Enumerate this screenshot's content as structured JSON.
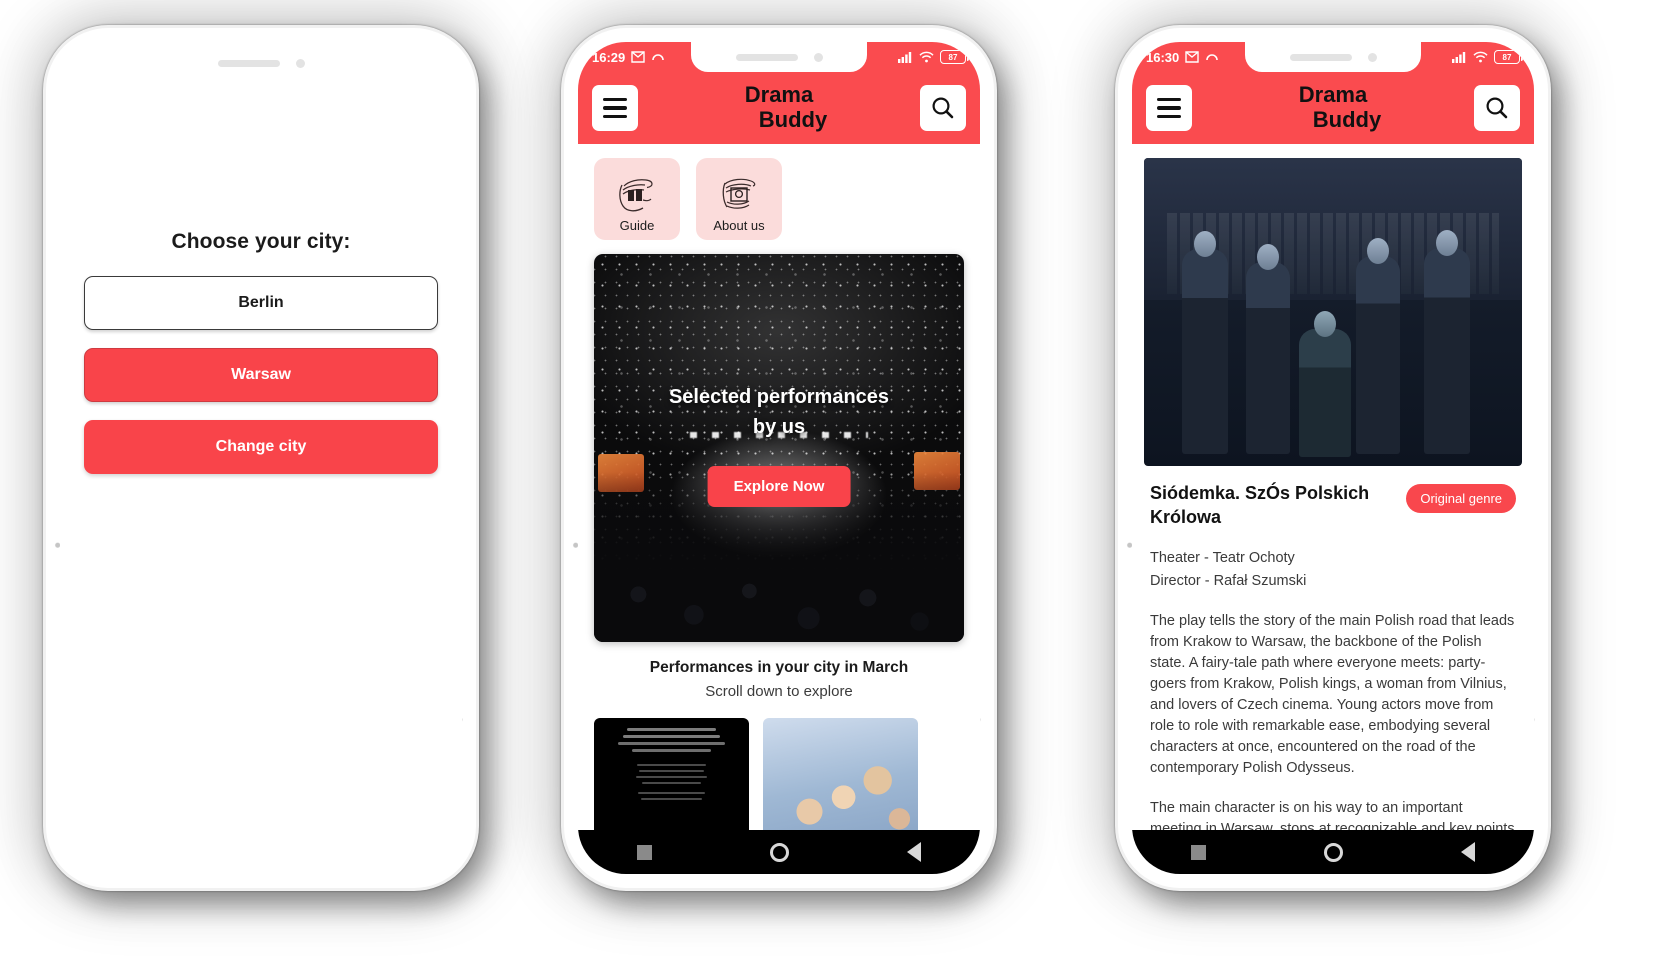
{
  "phone1": {
    "name": "city-chooser-screen",
    "title": "Choose your city:",
    "buttons": [
      {
        "label": "Berlin",
        "style": "outline"
      },
      {
        "label": "Warsaw",
        "style": "filled"
      },
      {
        "label": "Change city",
        "style": "filled"
      }
    ]
  },
  "phone2": {
    "name": "home-screen",
    "status": {
      "time": "16:29",
      "battery": "87"
    },
    "appbar": {
      "title_line1": "Drama",
      "title_line2": "Buddy",
      "menu_icon": "hamburger-icon",
      "search_icon": "search-icon"
    },
    "tiles": [
      {
        "label": "Guide",
        "icon": "guide-cards-icon"
      },
      {
        "label": "About us",
        "icon": "about-us-icon"
      }
    ],
    "hero": {
      "headline_line1": "Selected performances",
      "headline_line2": "by us",
      "cta": "Explore Now"
    },
    "section": {
      "title": "Performances in your city in March",
      "subtitle": "Scroll down to explore"
    },
    "nav": [
      "square-icon",
      "circle-icon",
      "back-triangle-icon"
    ]
  },
  "phone3": {
    "name": "performance-detail-screen",
    "status": {
      "time": "16:30",
      "battery": "87"
    },
    "appbar": {
      "title_line1": "Drama",
      "title_line2": "Buddy",
      "menu_icon": "hamburger-icon",
      "search_icon": "search-icon"
    },
    "detail": {
      "title": "Siódemka. SzÓs Polskich Królowa",
      "badge": "Original genre",
      "theater": "Theater - Teatr Ochoty",
      "director": "Director - Rafał Szumski",
      "paragraph1": "The play tells the story of the main Polish road that leads from Krakow to Warsaw, the backbone of the Polish state. A fairy-tale path where everyone meets: party-goers from Krakow, Polish kings, a woman from Vilnius, and lovers of Czech cinema. Young actors move from role to role with remarkable ease, embodying several characters at once, encountered on the road of the contemporary Polish Odysseus.",
      "paragraph2": "The main character is on his way to an important meeting in Warsaw, stops at recognizable and key points along the road, and listens to Polish radio."
    },
    "nav": [
      "square-icon",
      "circle-icon",
      "back-triangle-icon"
    ]
  },
  "colors": {
    "accent": "#fa4b4f",
    "tile_bg": "#fbdcdb",
    "text": "#1b1b1b"
  }
}
